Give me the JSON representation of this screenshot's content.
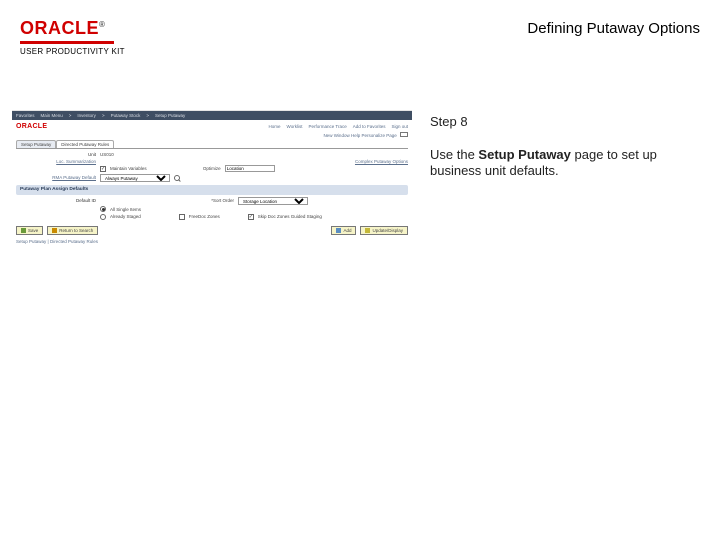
{
  "header": {
    "brand": "ORACLE",
    "trademark": "®",
    "tagline": "USER PRODUCTIVITY KIT",
    "title": "Defining Putaway Options"
  },
  "instruction": {
    "step_label": "Step 8",
    "text_before": "Use the ",
    "text_bold": "Setup Putaway",
    "text_after": " page to set up business unit defaults."
  },
  "thumb": {
    "breadcrumb": [
      "Favorites",
      "Main Menu",
      "Inventory",
      "Putaway Stock",
      "Setup Putaway"
    ],
    "top_links": [
      "Home",
      "Worklist",
      "Performance Trace",
      "Add to Favorites",
      "Sign out"
    ],
    "newwin": "New Window  Help  Personalize Page",
    "tabs": [
      "Setup Putaway",
      "Directed Putaway Rules"
    ],
    "unit_label": "Unit",
    "unit_value": "US010",
    "sect1_label": "Loc. Summarization",
    "sect1_link": "Complex Putaway Options",
    "maintain_vars": "Maintain Variables",
    "optimize": "Optimize",
    "opt_value": "Location",
    "sect2_label": "RMA Putaway Default",
    "sect2_select": "Always Putaway",
    "band_title": "Putaway Plan Assign Defaults",
    "default_lbl": "Default ID",
    "sort_lbl": "*Sort Order",
    "sort_value": "Storage Location",
    "r1": "All Single Items",
    "r2": "Already Staged",
    "chk_a": "FreeDoc Zones",
    "chk_b": "Skip Doc Zones Guided Staging",
    "btn_save": "Save",
    "btn_ret": "Return to Search",
    "btn_add": "Add",
    "btn_upd": "Update/Display",
    "footer": "Setup Putaway | Directed Putaway Rules"
  }
}
